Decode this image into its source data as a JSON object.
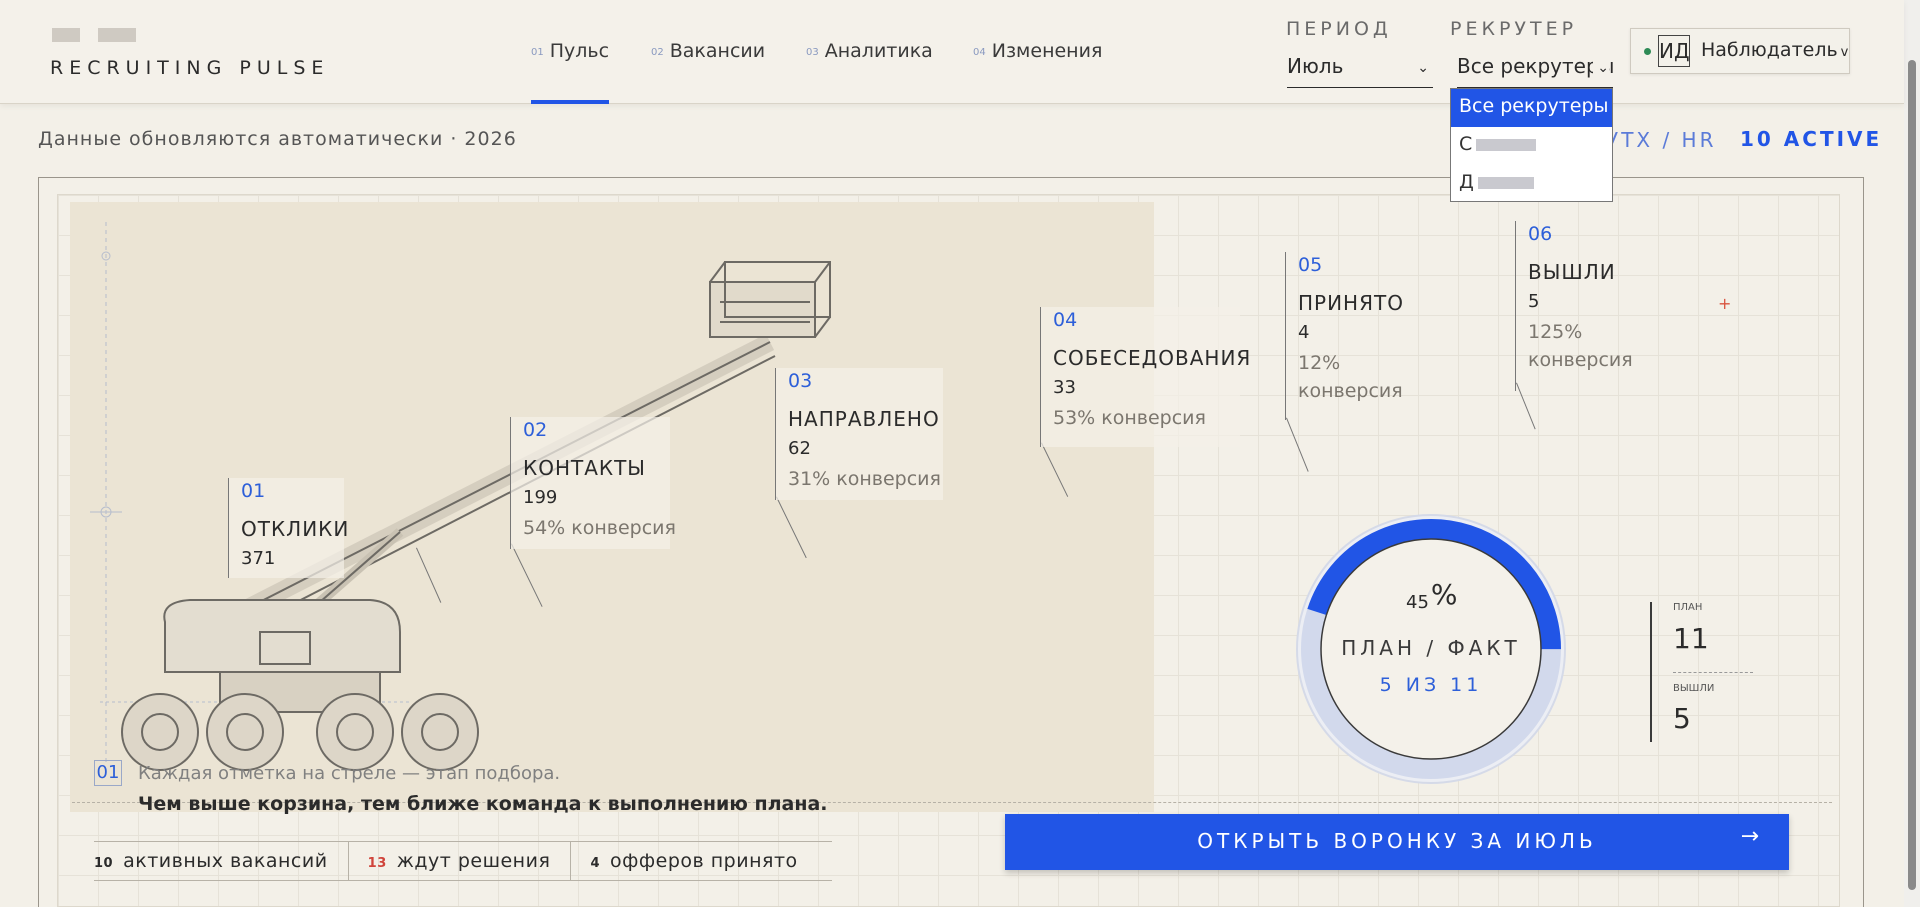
{
  "header": {
    "brand": "RECRUITING PULSE",
    "nav": [
      {
        "num": "01",
        "label": "Пульс"
      },
      {
        "num": "02",
        "label": "Вакансии"
      },
      {
        "num": "03",
        "label": "Аналитика"
      },
      {
        "num": "04",
        "label": "Изменения"
      }
    ],
    "period_label": "ПЕРИОД",
    "period_value": "Июль",
    "recruiter_label": "РЕКРУТЕР",
    "recruiter_value": "Все рекрутеры",
    "recruiter_options": [
      "Все рекрутеры",
      "С",
      "Д"
    ],
    "user_initials": "ИД",
    "user_role": "Наблюдатель"
  },
  "subheader": {
    "subtitle": "Данные обновляются автоматически · 2026",
    "hr_tag": "УТХ / HR",
    "active_tag": "10 ACTIVE"
  },
  "funnel": {
    "stages": [
      {
        "num": "01",
        "name": "ОТКЛИКИ",
        "value": "371",
        "conversion": ""
      },
      {
        "num": "02",
        "name": "КОНТАКТЫ",
        "value": "199",
        "conversion": "54% конверсия"
      },
      {
        "num": "03",
        "name": "НАПРАВЛЕНО",
        "value": "62",
        "conversion": "31% конверсия"
      },
      {
        "num": "04",
        "name": "СОБЕСЕДОВАНИЯ",
        "value": "33",
        "conversion": "53% конверсия"
      },
      {
        "num": "05",
        "name": "ПРИНЯТО",
        "value": "4",
        "conversion_pct": "12%",
        "conversion_word": "конверсия"
      },
      {
        "num": "06",
        "name": "ВЫШЛИ",
        "value": "5",
        "conversion_pct": "125%",
        "conversion_word": "конверсия"
      }
    ]
  },
  "gauge": {
    "value": "45",
    "unit": "%",
    "percent": 45,
    "label": "ПЛАН / ФАКТ",
    "sub": "5 ИЗ 11",
    "plan_label": "ПЛАН",
    "plan_value": "11",
    "out_label": "ВЫШЛИ",
    "out_value": "5"
  },
  "caption": {
    "num": "01",
    "line1": "Каждая отметка на стреле — этап подбора.",
    "line2": "Чем выше корзина, тем ближе команда к выполнению плана."
  },
  "stats": [
    {
      "num": "10",
      "label": "активных вакансий",
      "color": "#2b2b2b"
    },
    {
      "num": "13",
      "label": "ждут решения",
      "color": "#d0443b"
    },
    {
      "num": "4",
      "label": "офферов принято",
      "color": "#2b2b2b"
    }
  ],
  "cta": {
    "label": "ОТКРЫТЬ ВОРОНКУ ЗА ИЮЛЬ",
    "arrow": "→"
  },
  "colors": {
    "accent": "#2155e6",
    "background": "#f3f0e8",
    "warning": "#d0443b"
  }
}
